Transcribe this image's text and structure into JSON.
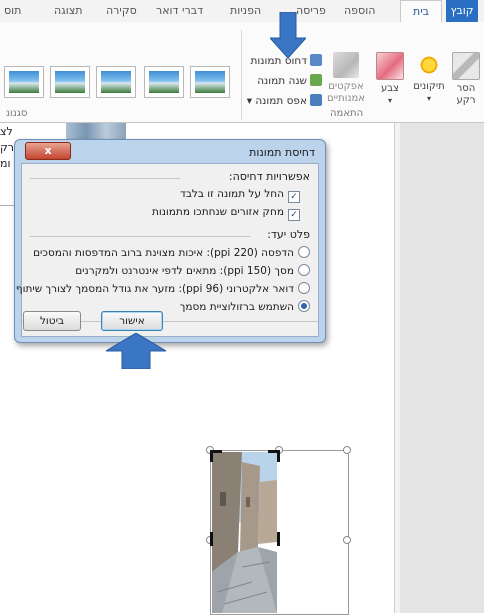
{
  "ribbon_tabs": {
    "file": "קובץ",
    "home": "בית",
    "insert": "הוספה",
    "design": "פריסה",
    "layout": "הפניות",
    "mailings": "דברי דואר",
    "review": "סקירה",
    "view": "תצוגה",
    "addins": "תוס"
  },
  "ribbon": {
    "remove_background_label": "הסר רקע",
    "corrections_label": "תיקונים",
    "color_label": "צבע",
    "artistic_effects_label": "אפקטים אמנותיים",
    "compress_pictures_label": "דחוס תמונות",
    "change_picture_label": "שנה תמונה",
    "reset_picture_label": "אפס תמונה",
    "adjust_group_label": "התאמה",
    "styles_group_label": "סגנונ"
  },
  "dialog": {
    "title": "דחיסת תמונות",
    "close_symbol": "x",
    "options_heading": "אפשרויות דחיסה:",
    "option_apply_only_this": "החל על תמונה זו בלבד",
    "option_delete_cropped": "מחק אזורים שנחתכו מתמונות",
    "target_heading": "פלט יעד:",
    "target_print": "הדפסה (220 ppi): איכות מצוינת ברוב המדפסות והמסכים",
    "target_screen": "מסך (150 ppi): מתאים לדפי אינטרנט ולמקרנים",
    "target_email": "דואר אלקטרוני (96 ppi): מזער את גודל המסמך לצורך שיתוף",
    "target_document": "השתמש ברזולוציית מסמך",
    "ok_label": "אישור",
    "cancel_label": "ביטול",
    "checkbox_checked_glyph": "✓"
  },
  "doc": {
    "left_fragment_1": "לצ",
    "left_fragment_2": "רק",
    "left_fragment_3": "ומ"
  },
  "colors": {
    "file_tab": "#2b6fc2",
    "arrow": "#3a76c4",
    "dialog_frame": "#bcd3ec",
    "close_button": "#c2452e"
  }
}
